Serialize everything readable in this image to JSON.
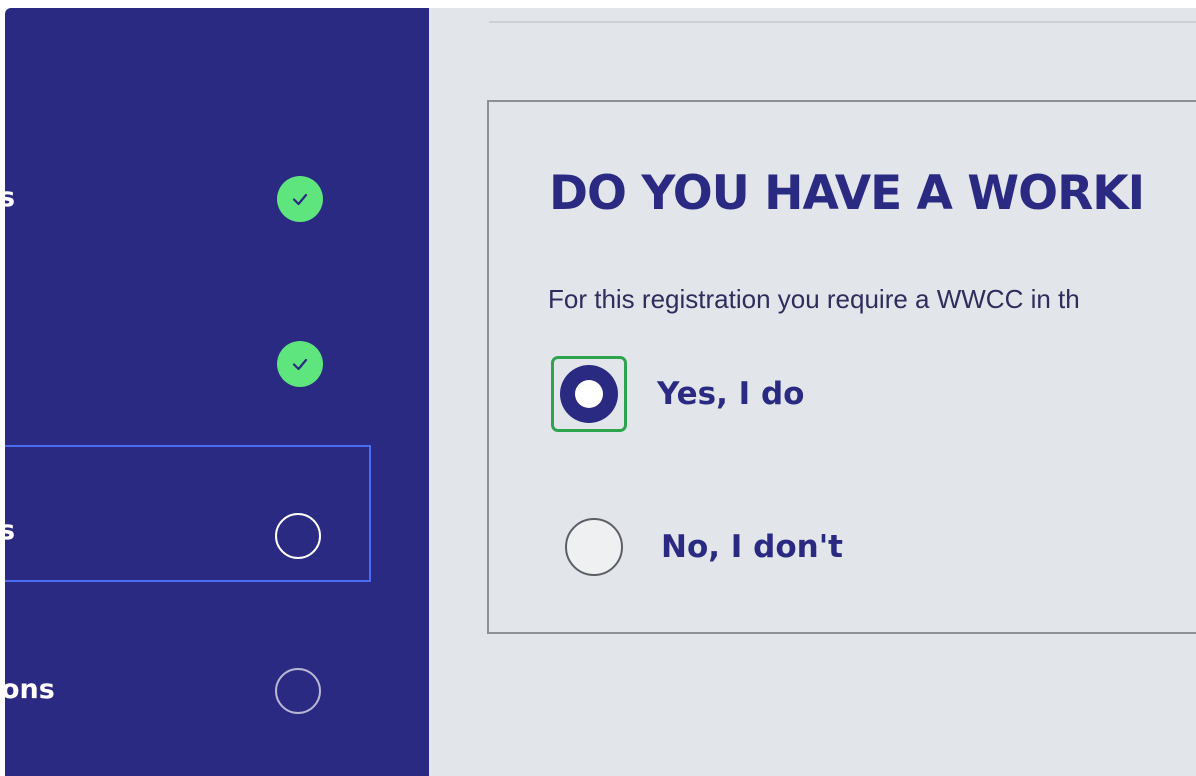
{
  "sidebar": {
    "steps": [
      {
        "label": "s",
        "status": "complete",
        "icon": "check-circle-icon"
      },
      {
        "label": "",
        "status": "complete",
        "icon": "check-circle-icon"
      },
      {
        "label": "s",
        "status": "current",
        "icon": "empty-circle-icon"
      },
      {
        "label": "ons",
        "status": "pending",
        "icon": "empty-circle-icon"
      }
    ]
  },
  "main": {
    "question": "DO YOU HAVE A WORKI",
    "hint": "For this registration you require a WWCC in th",
    "options": [
      {
        "label": "Yes, I do",
        "selected": true
      },
      {
        "label": "No, I don't",
        "selected": false
      }
    ]
  },
  "colors": {
    "sidebar_bg": "#2b2a83",
    "complete_green": "#5ee57d",
    "active_border": "#4a6cf0",
    "focus_green": "#2fa44f",
    "main_bg": "#e2e6ea",
    "heading": "#2b2a83"
  }
}
